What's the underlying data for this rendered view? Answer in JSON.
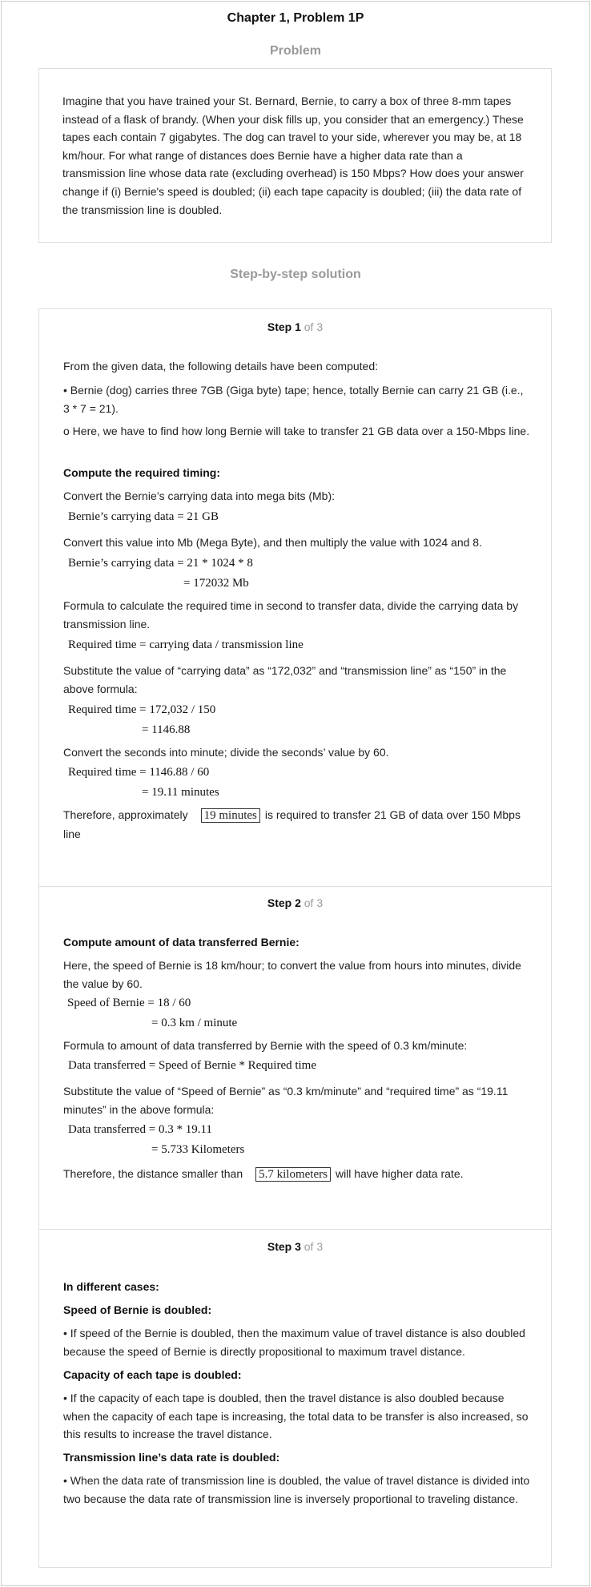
{
  "header": {
    "title": "Chapter 1, Problem 1P"
  },
  "problem": {
    "heading": "Problem",
    "text": "Imagine that you have trained your St. Bernard, Bernie, to carry a box of three 8-mm tapes instead of a flask of brandy. (When your disk fills up, you consider that an emergency.) These tapes each contain 7 gigabytes. The dog can travel to your side, wherever you may be, at 18 km/hour. For what range of distances does Bernie have a higher data rate than a transmission line whose data rate (excluding overhead) is 150 Mbps? How does your answer change if (i) Bernie's speed is doubled; (ii) each tape capacity is doubled; (iii) the data rate of the transmission line is doubled."
  },
  "solution": {
    "heading": "Step-by-step solution",
    "step1": {
      "label": "Step 1",
      "of": "of 3",
      "intro": "From the given data, the following details have been computed:",
      "bullet": "• Bernie (dog) carries three 7GB (Giga byte) tape; hence, totally Bernie can carry 21 GB (i.e., 3 * 7 = 21).",
      "note": "o Here, we have to find how long Bernie will take to transfer 21 GB data over a 150-Mbps line.",
      "subheading": "Compute the required timing:",
      "convert1": "Convert the Bernie’s carrying data into mega bits (Mb):",
      "eq1": "Bernie’s carrying data = 21 GB",
      "convert2": "Convert this value into Mb (Mega Byte), and then multiply the value with 1024 and 8.",
      "eq2a": "Bernie’s carrying data = 21 * 1024 * 8",
      "eq2b": "= 172032 Mb",
      "formula_text": "Formula to calculate the required time in second to transfer data, divide the carrying data by transmission line.",
      "eq3": "Required time = carrying data / transmission line",
      "substitute": "Substitute the value of “carrying data” as “172,032” and “transmission line” as “150” in the above formula:",
      "eq4a": "Required time = 172,032 / 150",
      "eq4b": "= 1146.88",
      "convert3": "Convert the seconds into minute; divide the seconds’ value by 60.",
      "eq5a": "Required time = 1146.88 / 60",
      "eq5b": "= 19.11 minutes",
      "conclusion_pre": "Therefore, approximately",
      "conclusion_boxed": "19 minutes",
      "conclusion_post": "is required to transfer 21 GB of data over 150 Mbps line"
    },
    "step2": {
      "label": "Step 2",
      "of": "of 3",
      "subheading": "Compute amount of data transferred Bernie:",
      "text1": "Here, the speed of Bernie is 18 km/hour; to convert the value from hours into minutes, divide the value by 60.",
      "eq1a": "Speed of Bernie = 18 / 60",
      "eq1b": "= 0.3 km / minute",
      "formula_text": "Formula to amount of data transferred by Bernie with the speed of 0.3 km/minute:",
      "eq2": "Data transferred = Speed of Bernie * Required time",
      "substitute": "Substitute the value of “Speed of Bernie” as “0.3 km/minute” and “required time” as “19.11 minutes” in the above formula:",
      "eq3a": "Data transferred = 0.3 * 19.11",
      "eq3b": "= 5.733 Kilometers",
      "conclusion_pre": "Therefore, the distance smaller than",
      "conclusion_boxed": "5.7 kilometers",
      "conclusion_post": "will have higher data rate."
    },
    "step3": {
      "label": "Step 3",
      "of": "of 3",
      "subheading": "In different cases:",
      "case1_title": "Speed of Bernie is doubled:",
      "case1_text": "• If speed of the Bernie is doubled, then the maximum value of travel distance is also doubled because the speed of Bernie is directly propositional to maximum travel distance.",
      "case2_title": "Capacity of each tape is doubled:",
      "case2_text": "• If the capacity of each tape is doubled, then the travel distance is also doubled because when the capacity of each tape is increasing, the total data to be transfer is also increased, so this results to increase the travel distance.",
      "case3_title": "Transmission line’s data rate is doubled:",
      "case3_text": "• When the data rate of transmission line is doubled, the value of travel distance is divided into two because the data rate of transmission line is inversely proportional to traveling distance."
    }
  }
}
